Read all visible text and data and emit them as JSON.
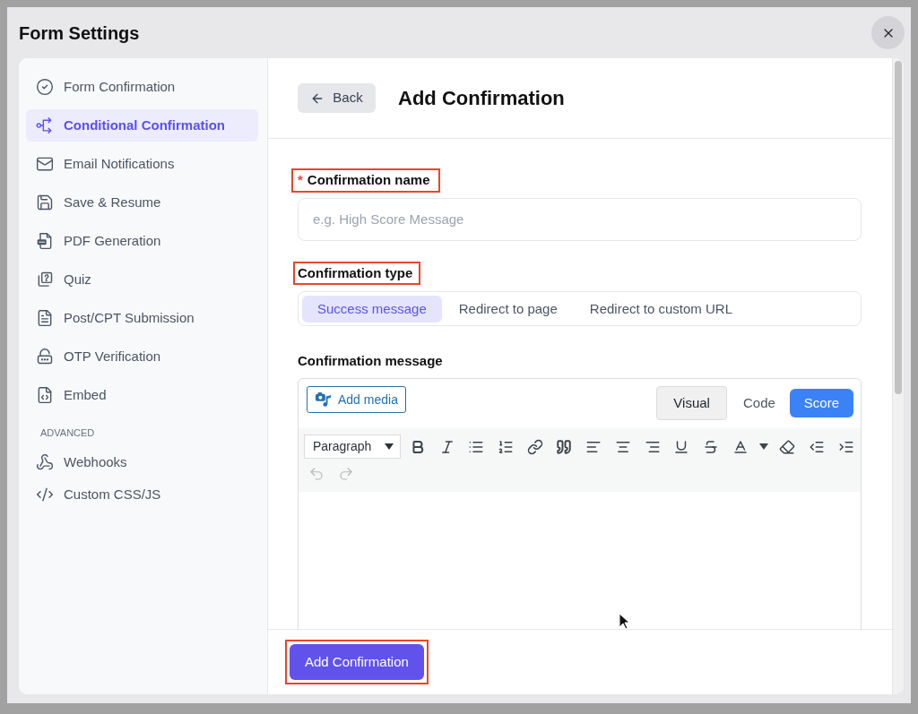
{
  "dialog": {
    "title": "Form Settings"
  },
  "sidebar": {
    "items": [
      {
        "label": "Form Confirmation",
        "kind": "check-circle",
        "selected": false
      },
      {
        "label": "Conditional Confirmation",
        "kind": "branch",
        "selected": true
      },
      {
        "label": "Email Notifications",
        "kind": "mail",
        "selected": false
      },
      {
        "label": "Save & Resume",
        "kind": "save",
        "selected": false
      },
      {
        "label": "PDF Generation",
        "kind": "pdf",
        "selected": false
      },
      {
        "label": "Quiz",
        "kind": "quiz",
        "selected": false
      },
      {
        "label": "Post/CPT Submission",
        "kind": "document",
        "selected": false
      },
      {
        "label": "OTP Verification",
        "kind": "otp",
        "selected": false
      },
      {
        "label": "Embed",
        "kind": "embed",
        "selected": false
      }
    ],
    "section_label": "ADVANCED",
    "advanced_items": [
      {
        "label": "Webhooks",
        "kind": "webhook",
        "selected": false
      },
      {
        "label": "Custom CSS/JS",
        "kind": "code",
        "selected": false
      }
    ]
  },
  "header": {
    "back_button": "Back",
    "title": "Add Confirmation"
  },
  "name_field": {
    "label": "Confirmation name",
    "required_mark": "*",
    "highlighted": true,
    "placeholder": "e.g. High Score Message"
  },
  "type_field": {
    "label": "Confirmation type",
    "highlighted": true,
    "options": [
      {
        "label": "Success message",
        "selected": true
      },
      {
        "label": "Redirect to page",
        "selected": false
      },
      {
        "label": "Redirect to custom URL",
        "selected": false
      }
    ]
  },
  "message_field": {
    "label": "Confirmation message",
    "add_media_button": "Add media",
    "modes": [
      {
        "label": "Visual",
        "selected": true
      },
      {
        "label": "Code",
        "selected": false
      }
    ],
    "score_button": "Score",
    "format_select": "Paragraph",
    "toolbar": [
      {
        "kind": "bold",
        "disabled": false
      },
      {
        "kind": "italic",
        "disabled": false
      },
      {
        "kind": "bullet-list",
        "disabled": false
      },
      {
        "kind": "numbered-list",
        "disabled": false
      },
      {
        "kind": "link",
        "disabled": false
      },
      {
        "kind": "quote",
        "disabled": false
      },
      {
        "kind": "align-left",
        "disabled": false
      },
      {
        "kind": "align-center",
        "disabled": false
      },
      {
        "kind": "align-right",
        "disabled": false
      },
      {
        "kind": "underline",
        "disabled": false
      },
      {
        "kind": "strikethrough",
        "disabled": false
      },
      {
        "kind": "text-color",
        "disabled": false
      },
      {
        "kind": "color-caret",
        "disabled": false
      },
      {
        "kind": "eraser",
        "disabled": false
      },
      {
        "kind": "outdent",
        "disabled": false
      },
      {
        "kind": "indent",
        "disabled": false
      },
      {
        "kind": "undo",
        "disabled": true
      },
      {
        "kind": "redo",
        "disabled": true
      }
    ]
  },
  "footer": {
    "submit_button": "Add Confirmation",
    "highlighted": true
  }
}
